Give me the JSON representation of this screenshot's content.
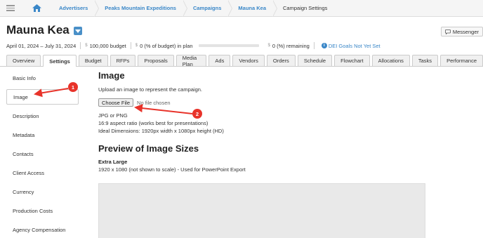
{
  "breadcrumb": {
    "items": [
      "Advertisers",
      "Peaks Mountain Expeditions",
      "Campaigns",
      "Mauna Kea",
      "Campaign Settings"
    ]
  },
  "campaign": {
    "title": "Mauna Kea",
    "date_range": "April 01, 2024 – July 31, 2024",
    "budget": "100,000 budget",
    "in_plan": "0 (% of budget) in plan",
    "remaining": "0 (%) remaining",
    "dei_label": "DEI Goals Not Yet Set"
  },
  "messenger": {
    "label": "Messenger"
  },
  "tabs": [
    {
      "label": "Overview"
    },
    {
      "label": "Settings"
    },
    {
      "label": "Budget"
    },
    {
      "label": "RFPs"
    },
    {
      "label": "Proposals"
    },
    {
      "label": "Media Plan"
    },
    {
      "label": "Ads"
    },
    {
      "label": "Vendors"
    },
    {
      "label": "Orders"
    },
    {
      "label": "Schedule"
    },
    {
      "label": "Flowchart"
    },
    {
      "label": "Allocations"
    },
    {
      "label": "Tasks"
    },
    {
      "label": "Performance"
    }
  ],
  "active_tab": "Settings",
  "sidenav": [
    {
      "label": "Basic Info"
    },
    {
      "label": "Image"
    },
    {
      "label": "Description"
    },
    {
      "label": "Metadata"
    },
    {
      "label": "Contacts"
    },
    {
      "label": "Client Access"
    },
    {
      "label": "Currency"
    },
    {
      "label": "Production Costs"
    },
    {
      "label": "Agency Compensation"
    }
  ],
  "active_nav": "Image",
  "image_section": {
    "heading": "Image",
    "instructions": "Upload an image to represent the campaign.",
    "choose_file_label": "Choose File",
    "no_file_text": "No file chosen",
    "format_note": "JPG or PNG",
    "aspect_note": "16:9 aspect ratio (works best for presentations)",
    "dimensions_note": "Ideal Dimensions: 1920px width x 1080px height (HD)"
  },
  "preview_section": {
    "heading": "Preview of Image Sizes",
    "size_title": "Extra Large",
    "size_desc": "1920 x 1080 (not shown to scale) - Used for PowerPoint Export"
  },
  "annotations": [
    {
      "number": "1"
    },
    {
      "number": "2"
    }
  ],
  "colors": {
    "link": "#3a87c8",
    "annotation": "#e8332a",
    "header_bg": "#f5f5f5"
  }
}
